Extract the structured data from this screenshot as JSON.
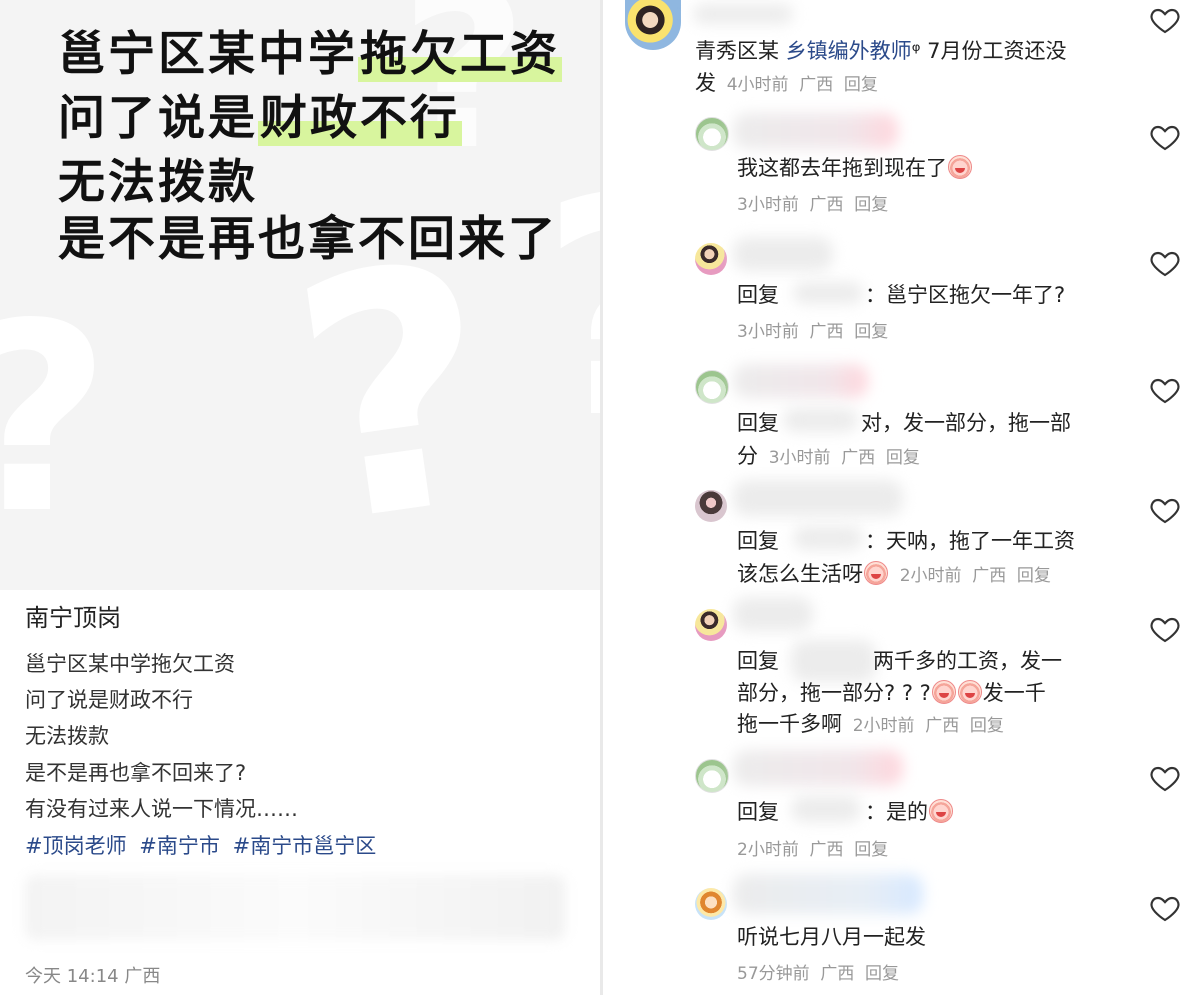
{
  "post": {
    "cover": {
      "line1_pre": "邕宁区某中学",
      "line1_hl": "拖欠工资",
      "line2_pre": "问了说是",
      "line2_hl": "财政不行",
      "line3": "无法拨款",
      "line4": "是不是再也拿不回来了"
    },
    "title": "南宁顶岗",
    "body": [
      "邕宁区某中学拖欠工资",
      "问了说是财政不行",
      "无法拨款",
      "是不是再也拿不回来了?",
      "有没有过来人说一下情况……"
    ],
    "tags": [
      "#顶岗老师",
      "#南宁市",
      "#南宁市邕宁区"
    ],
    "meta": "今天 14:14 广西"
  },
  "comments": [
    {
      "text_a": "青秀区某 ",
      "text_link": "乡镇编外教师",
      "text_b": "ᵠ 7月份工资还没",
      "text_c": "发",
      "time": "4小时前",
      "region": "广西",
      "reply": "回复"
    },
    {
      "text": "我这都去年拖到现在了",
      "time": "3小时前",
      "region": "广西",
      "reply": "回复"
    },
    {
      "prefix": "回复",
      "sep": "：",
      "text": "邕宁区拖欠一年了?",
      "time": "3小时前",
      "region": "广西",
      "reply": "回复"
    },
    {
      "prefix": "回复",
      "text": "对，发一部分，拖一部",
      "text2": "分",
      "time": "3小时前",
      "region": "广西",
      "reply": "回复"
    },
    {
      "prefix": "回复",
      "sep": "：",
      "text": "天呐，拖了一年工资",
      "text2": "该怎么生活呀",
      "time": "2小时前",
      "region": "广西",
      "reply": "回复"
    },
    {
      "prefix": "回复",
      "text": "两千多的工资，发一",
      "text2": "部分，拖一部分? ? ?",
      "text3": "发一千",
      "text4": "拖一千多啊",
      "time": "2小时前",
      "region": "广西",
      "reply": "回复"
    },
    {
      "prefix": "回复",
      "sep": "：",
      "text": "是的",
      "time": "2小时前",
      "region": "广西",
      "reply": "回复"
    },
    {
      "text": "听说七月八月一起发",
      "time": "57分钟前",
      "region": "广西",
      "reply": "回复"
    }
  ],
  "icons": {
    "like": "heart-outline-icon",
    "emoji": "crying-face-emoji"
  },
  "colors": {
    "highlight": "#d8f59e",
    "link": "#2b4a8a",
    "meta": "#999999"
  }
}
